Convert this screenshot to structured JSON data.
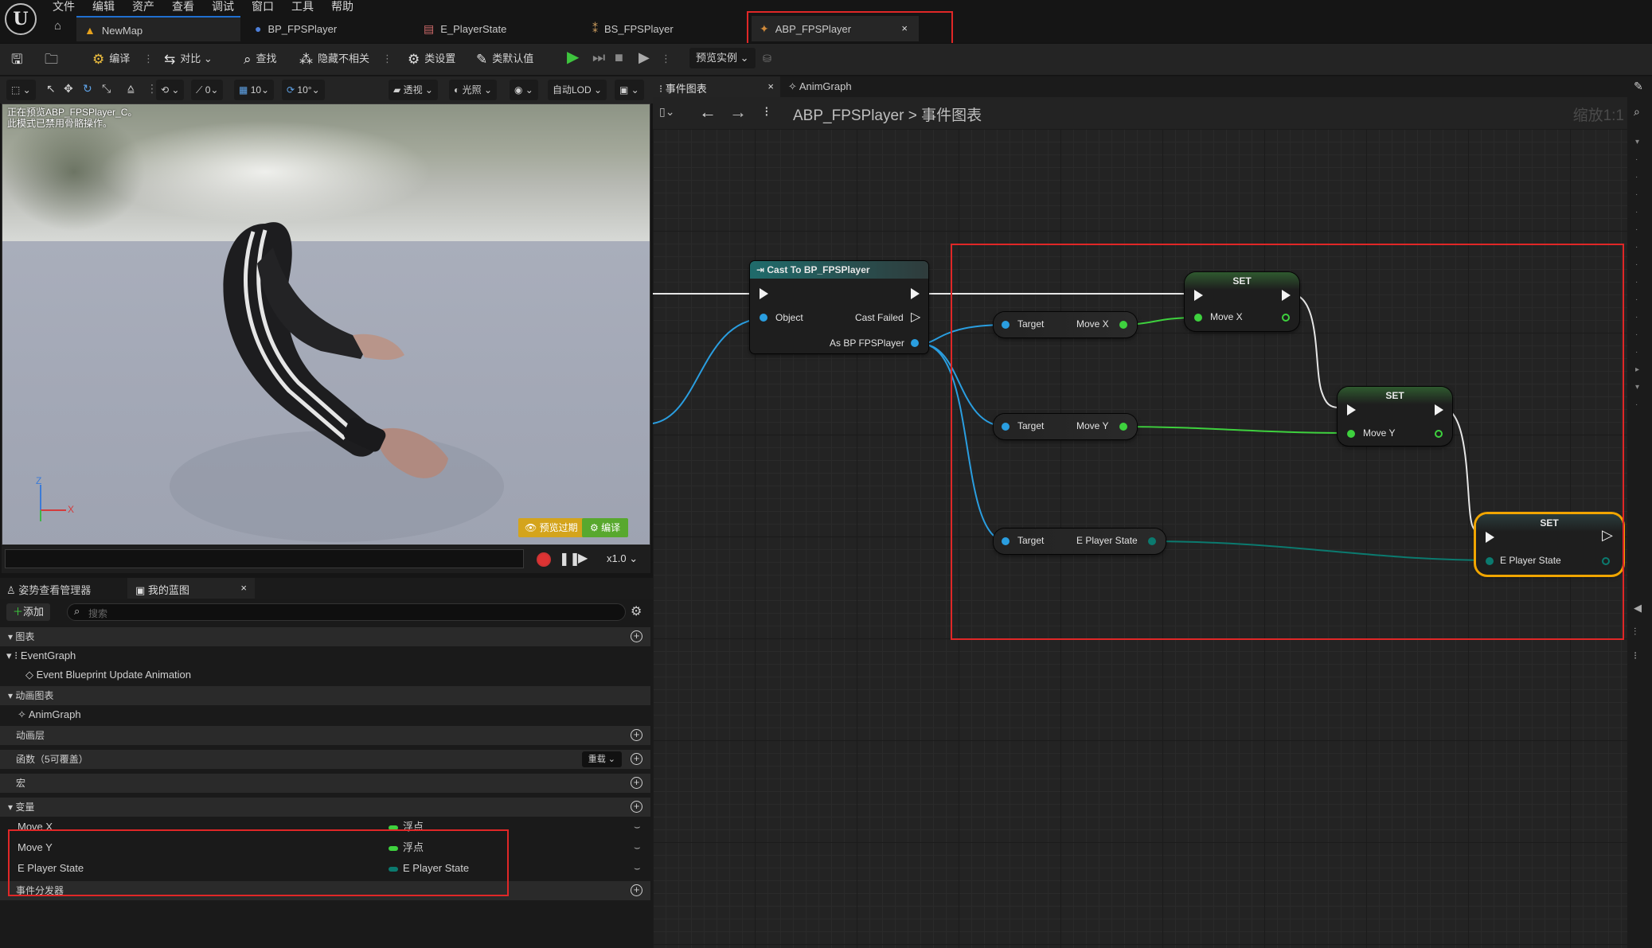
{
  "menu": [
    "文件",
    "编辑",
    "资产",
    "查看",
    "调试",
    "窗口",
    "工具",
    "帮助"
  ],
  "tabs": [
    {
      "label": "NewMap"
    },
    {
      "label": "BP_FPSPlayer"
    },
    {
      "label": "E_PlayerState"
    },
    {
      "label": "BS_FPSPlayer"
    },
    {
      "label": "ABP_FPSPlayer",
      "close": "×"
    }
  ],
  "toolbar": {
    "compile": "编译",
    "diff": "对比",
    "find": "查找",
    "hide_unrelated": "隐藏不相关",
    "class_settings": "类设置",
    "class_defaults": "类默认值",
    "preview_instance": "预览实例"
  },
  "viewport_toolbar": {
    "snap_translate": "10",
    "snap_rotate": "10°",
    "perspective": "透视",
    "lighting": "光照",
    "lod": "自动LOD",
    "scale_val": "0"
  },
  "viewport": {
    "info_line1": "正在预览ABP_FPSPlayer_C。",
    "info_line2": "此模式已禁用骨骼操作。",
    "axis_z": "Z",
    "axis_x": "X",
    "preview_button": "预览过期",
    "compile_button": "编译",
    "playback_speed": "x1.0"
  },
  "left_panel": {
    "tab_pose": "姿势查看管理器",
    "tab_blueprint": "我的蓝图",
    "add_button": "添加",
    "search_placeholder": "搜索",
    "sections": {
      "graphs": "图表",
      "anim_graphs": "动画图表",
      "anim_layers": "动画层",
      "functions": "函数（5可覆盖）",
      "macros": "宏",
      "variables": "变量",
      "dispatchers": "事件分发器"
    },
    "override_button": "重载",
    "tree": {
      "event_graph": "EventGraph",
      "event_update": "Event Blueprint Update Animation",
      "anim_graph": "AnimGraph"
    },
    "variables": [
      {
        "name": "Move X",
        "type": "浮点",
        "color": "#3ed13e"
      },
      {
        "name": "Move Y",
        "type": "浮点",
        "color": "#3ed13e"
      },
      {
        "name": "E Player State",
        "type": "E Player State",
        "color": "#0b7a6f"
      }
    ]
  },
  "graph_panel": {
    "tab_event": "事件图表",
    "tab_anim": "AnimGraph",
    "breadcrumb_bp": "ABP_FPSPlayer",
    "breadcrumb_sep": ">",
    "breadcrumb_graph": "事件图表",
    "zoom": "缩放1:1"
  },
  "nodes": {
    "cast": {
      "title": "Cast To BP_FPSPlayer",
      "object": "Object",
      "cast_failed": "Cast Failed",
      "as_bp": "As BP FPSPlayer"
    },
    "getx": {
      "target": "Target",
      "value": "Move X"
    },
    "gety": {
      "target": "Target",
      "value": "Move Y"
    },
    "getstate": {
      "target": "Target",
      "value": "E Player State"
    },
    "setx": {
      "title": "SET",
      "pin": "Move X"
    },
    "sety": {
      "title": "SET",
      "pin": "Move Y"
    },
    "setstate": {
      "title": "SET",
      "pin": "E Player State"
    }
  },
  "colors": {
    "accent_blue": "#1f6fd0",
    "float_green": "#3ed13e",
    "enum_teal": "#0b7a6f",
    "object_blue": "#2a9ee0",
    "highlight_red": "#e02727",
    "selected_orange": "#f0a500"
  }
}
